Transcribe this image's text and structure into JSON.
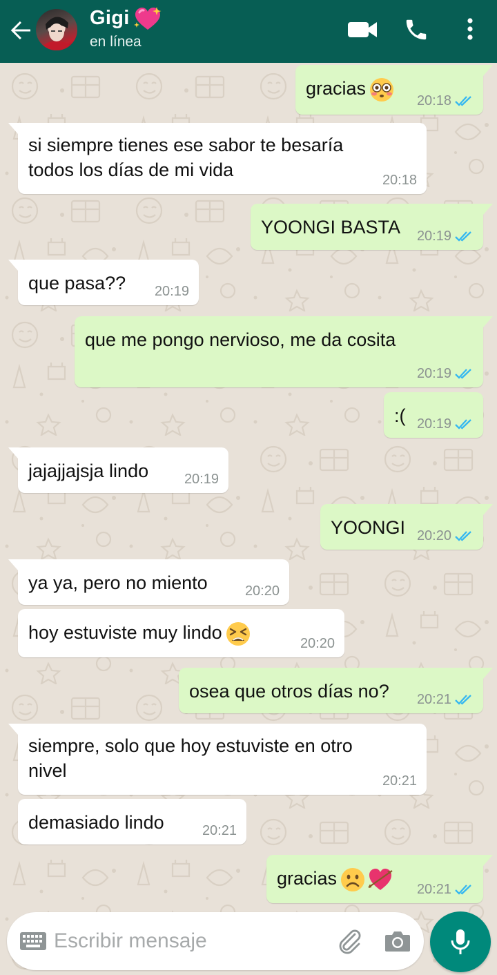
{
  "header": {
    "contact_name": "Gigi",
    "status": "en línea",
    "name_emoji": "sparkling-heart-icon",
    "colors": {
      "bar": "#075e54",
      "text": "#ffffff"
    }
  },
  "messages": [
    {
      "direction": "out",
      "text": "gracias",
      "emoji": "flushed-face-icon",
      "time": "20:18",
      "read": true
    },
    {
      "direction": "in",
      "lines": [
        "si siempre tienes ese sabor te besaría",
        "todos los días de mi vida"
      ],
      "time": "20:18"
    },
    {
      "direction": "out",
      "text": "YOONGI BASTA",
      "time": "20:19",
      "read": true
    },
    {
      "direction": "in",
      "text": "que pasa??",
      "time": "20:19"
    },
    {
      "direction": "out",
      "text": "que me pongo nervioso, me da cosita",
      "time": "20:19",
      "read": true
    },
    {
      "direction": "out",
      "text": ":(",
      "time": "20:19",
      "read": true
    },
    {
      "direction": "in",
      "text": "jajajjajsja lindo",
      "time": "20:19"
    },
    {
      "direction": "out",
      "text": "YOONGI",
      "time": "20:20",
      "read": true
    },
    {
      "direction": "in",
      "text": "ya ya, pero no miento",
      "time": "20:20"
    },
    {
      "direction": "in",
      "text": "hoy estuviste muy lindo",
      "emoji": "tired-face-icon",
      "time": "20:20"
    },
    {
      "direction": "out",
      "text": "osea que otros días no?",
      "time": "20:21",
      "read": true
    },
    {
      "direction": "in",
      "lines": [
        "siempre, solo que hoy estuviste en otro",
        "nivel"
      ],
      "time": "20:21"
    },
    {
      "direction": "in",
      "text": "demasiado lindo",
      "time": "20:21"
    },
    {
      "direction": "out",
      "text": "gracias",
      "emojis": [
        "frowning-face-icon",
        "heart-with-arrow-icon"
      ],
      "time": "20:21",
      "read": true
    }
  ],
  "composer": {
    "placeholder": "Escribir mensaje",
    "value": ""
  },
  "colors": {
    "outgoing_bubble": "#dcf8c6",
    "incoming_bubble": "#ffffff",
    "read_ticks": "#34b7f1",
    "fab": "#00897b",
    "wallpaper": "#e8e1d8"
  }
}
